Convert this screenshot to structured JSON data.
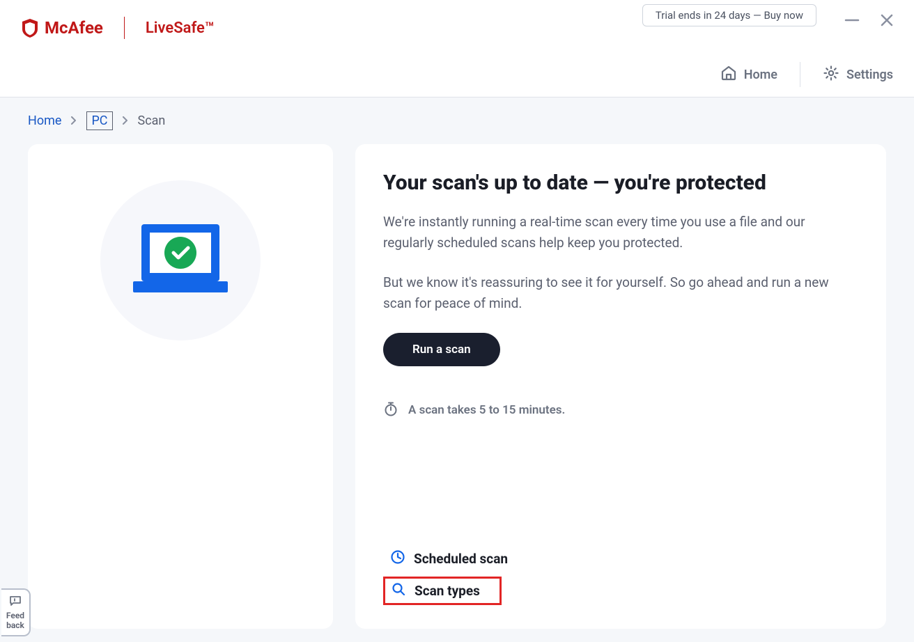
{
  "brand": {
    "name": "McAfee",
    "product": "LiveSafe™"
  },
  "trial": {
    "label": "Trial ends in 24 days — Buy now"
  },
  "nav": {
    "home": "Home",
    "settings": "Settings"
  },
  "breadcrumb": {
    "home": "Home",
    "pc": "PC",
    "scan": "Scan"
  },
  "panel": {
    "title": "Your scan's up to date — you're protected",
    "p1": "We're instantly running a real-time scan every time you use a file and our regularly scheduled scans help keep you protected.",
    "p2": "But we know it's reassuring to see it for yourself. So go ahead and run a new scan for peace of mind.",
    "run_scan": "Run a scan",
    "scan_time": "A scan takes 5 to 15 minutes."
  },
  "links": {
    "scheduled": "Scheduled scan",
    "types": "Scan types"
  },
  "feedback": {
    "line1": "Feed",
    "line2": "back"
  }
}
